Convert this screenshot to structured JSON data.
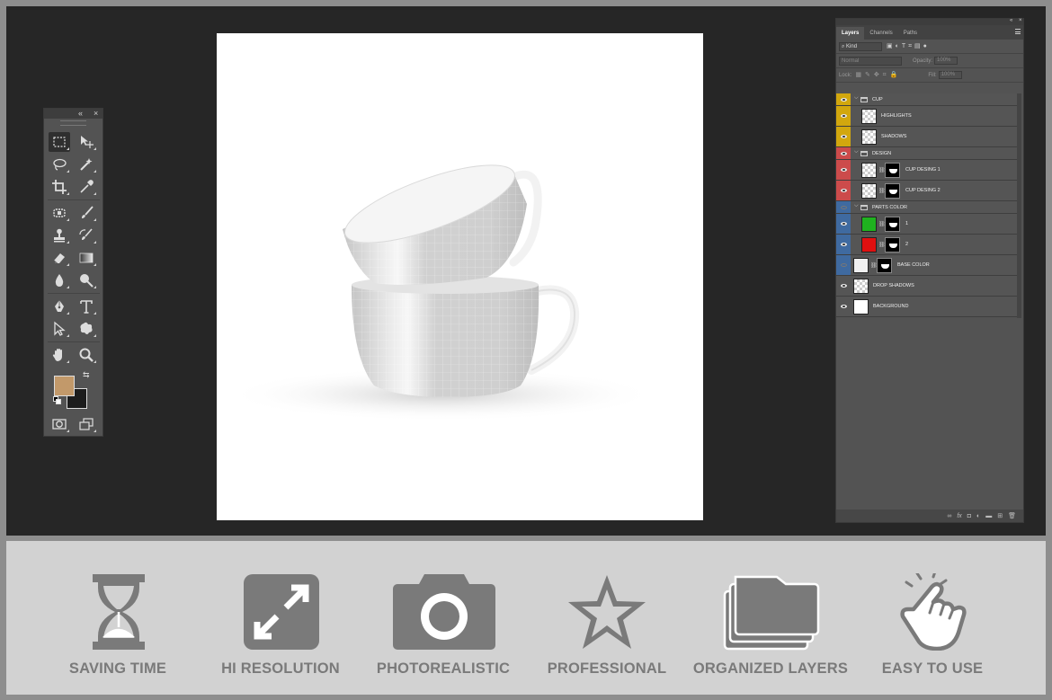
{
  "layers_panel": {
    "tabs": [
      "Layers",
      "Channels",
      "Paths"
    ],
    "active_tab": "Layers",
    "filter_kind": "Kind",
    "blend_mode": "Normal",
    "opacity_label": "Opacity:",
    "opacity_value": "100%",
    "lock_label": "Lock:",
    "fill_label": "Fill:",
    "fill_value": "100%",
    "layers": [
      {
        "name": "CUP",
        "type": "group",
        "color": "#d2a70e",
        "visible": true
      },
      {
        "name": "HIGHLIGHTS",
        "type": "layer",
        "color": "#d2a70e",
        "visible": true,
        "indent": 1
      },
      {
        "name": "SHADOWS",
        "type": "layer",
        "color": "#d2a70e",
        "visible": true,
        "indent": 1
      },
      {
        "name": "DESIGN",
        "type": "group",
        "color": "#cc4b4b",
        "visible": true
      },
      {
        "name": "CUP DESING 1",
        "type": "smart",
        "color": "#cc4b4b",
        "visible": true,
        "indent": 1
      },
      {
        "name": "CUP DESING 2",
        "type": "smart",
        "color": "#cc4b4b",
        "visible": true,
        "indent": 1
      },
      {
        "name": "PARTS COLOR",
        "type": "group",
        "color": "#3f6aa0",
        "visible": false
      },
      {
        "name": "1",
        "type": "fill",
        "color": "#3f6aa0",
        "visible": true,
        "indent": 1,
        "fill": "#1fb21f"
      },
      {
        "name": "2",
        "type": "fill",
        "color": "#3f6aa0",
        "visible": true,
        "indent": 1,
        "fill": "#e01010"
      },
      {
        "name": "BASE COLOR",
        "type": "fill",
        "color": "#3f6aa0",
        "visible": false,
        "fill": "#f0f0f0"
      },
      {
        "name": "DROP SHADOWS",
        "type": "layer",
        "color": "#555555",
        "visible": true
      },
      {
        "name": "BACKGROUND",
        "type": "bg",
        "color": "#555555",
        "visible": true
      }
    ]
  },
  "features": [
    {
      "label": "SAVING TIME",
      "icon": "hourglass-icon"
    },
    {
      "label": "HI RESOLUTION",
      "icon": "expand-arrows-icon"
    },
    {
      "label": "PHOTOREALISTIC",
      "icon": "camera-icon"
    },
    {
      "label": "PROFESSIONAL",
      "icon": "star-icon"
    },
    {
      "label": "ORGANIZED LAYERS",
      "icon": "folders-icon"
    },
    {
      "label": "EASY TO USE",
      "icon": "hand-pointer-icon"
    }
  ],
  "colors": {
    "foreground": "#c2996a",
    "background": "#1c1c1c",
    "workspace": "#262626",
    "panel": "#535353",
    "feature_bar": "#d2d2d2",
    "feature_icon": "#7a7a7a"
  }
}
